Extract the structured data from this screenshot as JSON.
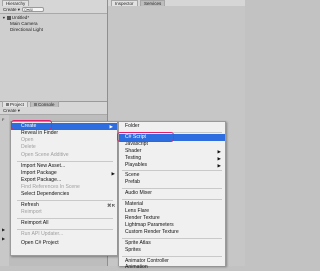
{
  "hierarchy": {
    "tab": "Hierarchy",
    "create": "Create ▾",
    "search_placeholder": "Q▾All",
    "scene": "Untitled*",
    "children": [
      "Main Camera",
      "Directional Light"
    ]
  },
  "inspector": {
    "tabs": [
      "Inspector",
      "Services"
    ]
  },
  "bottom": {
    "tabs": [
      "Project",
      "Console"
    ],
    "create": "Create ▾",
    "side": [
      "F",
      "▶",
      "▶"
    ]
  },
  "context_menu": {
    "items": [
      {
        "label": "Create",
        "arrow": "▶"
      },
      {
        "label": "Reveal in Finder"
      },
      {
        "label": "Open"
      },
      {
        "label": "Delete"
      },
      {
        "label": "Open Scene Additive"
      },
      {
        "label": "Import New Asset..."
      },
      {
        "label": "Import Package",
        "arrow": "▶"
      },
      {
        "label": "Export Package..."
      },
      {
        "label": "Find References In Scene"
      },
      {
        "label": "Select Dependencies"
      },
      {
        "label": "Refresh",
        "shortcut": "⌘R"
      },
      {
        "label": "Reimport"
      },
      {
        "label": "Reimport All"
      },
      {
        "label": "Run API Updater..."
      },
      {
        "label": "Open C# Project"
      }
    ]
  },
  "submenu": {
    "items": [
      {
        "label": "Folder"
      },
      {
        "label": "C# Script"
      },
      {
        "label": "Javascript"
      },
      {
        "label": "Shader",
        "arrow": "▶"
      },
      {
        "label": "Testing",
        "arrow": "▶"
      },
      {
        "label": "Playables",
        "arrow": "▶"
      },
      {
        "label": "Scene"
      },
      {
        "label": "Prefab"
      },
      {
        "label": "Audio Mixer"
      },
      {
        "label": "Material"
      },
      {
        "label": "Lens Flare"
      },
      {
        "label": "Render Texture"
      },
      {
        "label": "Lightmap Parameters"
      },
      {
        "label": "Custom Render Texture"
      },
      {
        "label": "Sprite Atlas"
      },
      {
        "label": "Sprites"
      },
      {
        "label": "Animator Controller"
      },
      {
        "label": "Animation"
      }
    ]
  },
  "colors": {
    "selection": "#2e6de0",
    "highlight_outline": "#e0206a"
  }
}
